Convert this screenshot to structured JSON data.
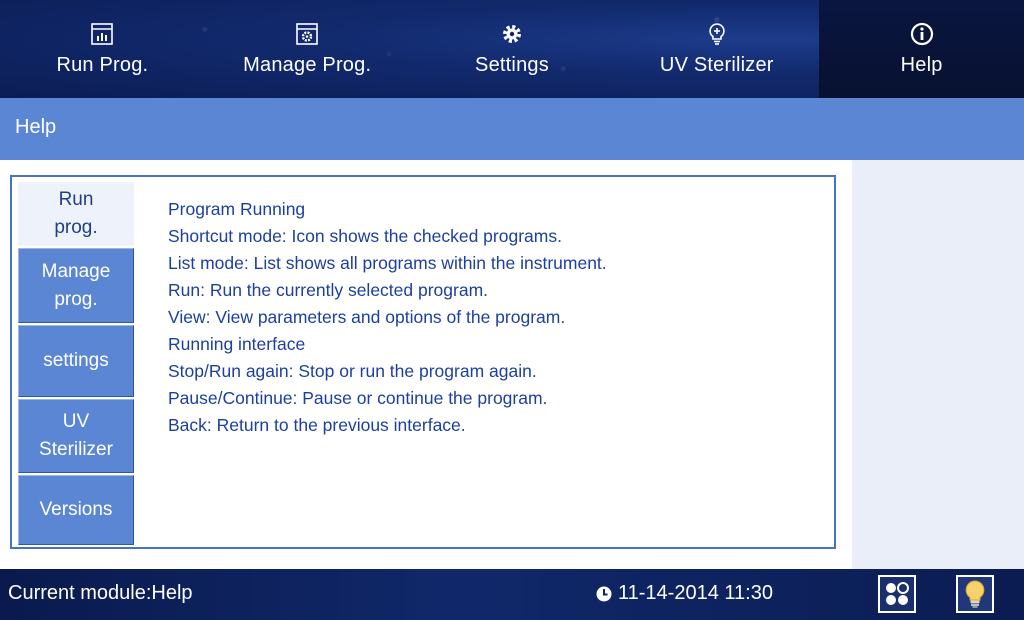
{
  "nav": {
    "tabs": [
      {
        "label": "Run Prog.",
        "icon": "bar-chart-icon"
      },
      {
        "label": "Manage Prog.",
        "icon": "gear-box-icon"
      },
      {
        "label": "Settings",
        "icon": "gear-icon"
      },
      {
        "label": "UV Sterilizer",
        "icon": "bulb-icon"
      },
      {
        "label": "Help",
        "icon": "info-icon"
      }
    ],
    "active": "Help"
  },
  "header": {
    "title": "Help"
  },
  "sidebar": {
    "items": [
      {
        "label": "Run\nprog."
      },
      {
        "label": "Manage\nprog."
      },
      {
        "label": "settings"
      },
      {
        "label": "UV\nSterilizer"
      },
      {
        "label": "Versions"
      }
    ],
    "active": "Run prog."
  },
  "content": {
    "lines": [
      "Program Running",
      "Shortcut mode: Icon shows the checked programs.",
      "List mode: List shows all programs within the instrument.",
      "Run: Run the currently selected program.",
      "View: View parameters and options of the program.",
      "Running interface",
      "Stop/Run again: Stop or run the program again.",
      "Pause/Continue: Pause or continue the program.",
      "Back: Return to the previous interface."
    ]
  },
  "footer": {
    "module": "Current module:Help",
    "datetime": "11-14-2014 11:30",
    "icons": [
      "grid-icon",
      "lightbulb-icon"
    ]
  },
  "colors": {
    "nav_bg": "#122a6e",
    "subheader_bg": "#5b86d3",
    "sidetab_bg": "#5b86d3",
    "text_blue": "#1c3fa0",
    "border": "#4a72c4"
  }
}
